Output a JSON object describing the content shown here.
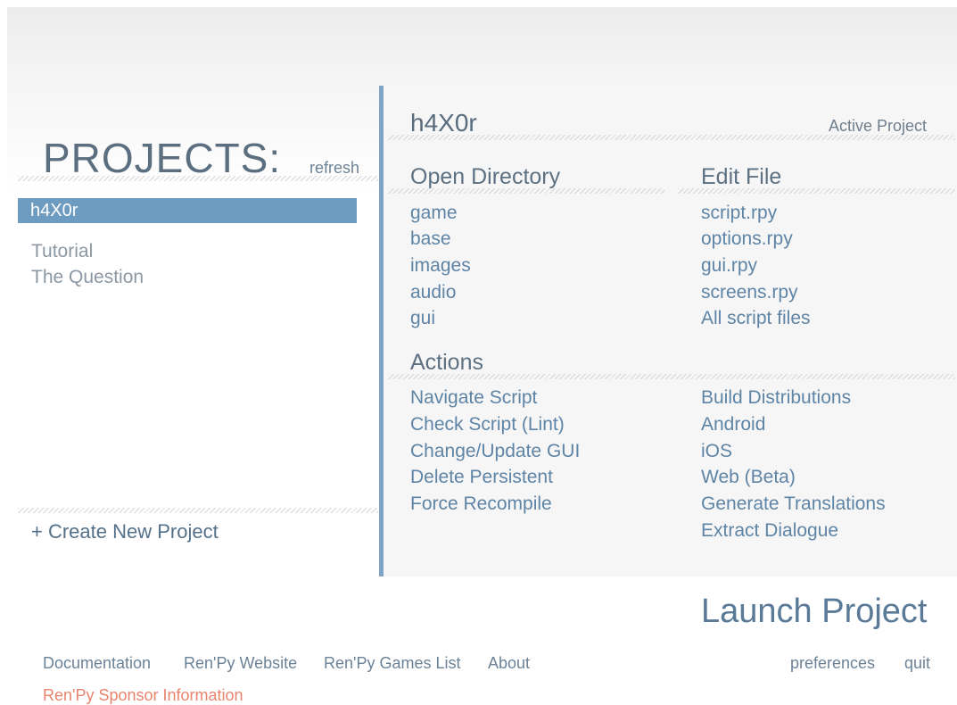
{
  "projects_panel": {
    "title": "PROJECTS:",
    "refresh_label": "refresh",
    "selected_project": "h4X0r",
    "other_projects": [
      "Tutorial",
      "The Question"
    ],
    "create_label": "+ Create New Project"
  },
  "project": {
    "name": "h4X0r",
    "active_label": "Active Project"
  },
  "open_directory": {
    "heading": "Open Directory",
    "items": [
      "game",
      "base",
      "images",
      "audio",
      "gui"
    ]
  },
  "edit_file": {
    "heading": "Edit File",
    "items": [
      "script.rpy",
      "options.rpy",
      "gui.rpy",
      "screens.rpy",
      "All script files"
    ]
  },
  "actions": {
    "heading": "Actions",
    "left_items": [
      "Navigate Script",
      "Check Script (Lint)",
      "Change/Update GUI",
      "Delete Persistent",
      "Force Recompile"
    ],
    "right_items": [
      "Build Distributions",
      "Android",
      "iOS",
      "Web (Beta)",
      "Generate Translations",
      "Extract Dialogue"
    ]
  },
  "launch_label": "Launch Project",
  "footer": {
    "links": [
      "Documentation",
      "Ren'Py Website",
      "Ren'Py Games List",
      "About"
    ],
    "preferences": "preferences",
    "quit": "quit",
    "sponsor": "Ren'Py Sponsor Information"
  },
  "colors": {
    "accent": "#6e9bc0",
    "panel_border": "#7ea5c5",
    "link": "#5e84a6",
    "sponsor": "#e8846e"
  }
}
